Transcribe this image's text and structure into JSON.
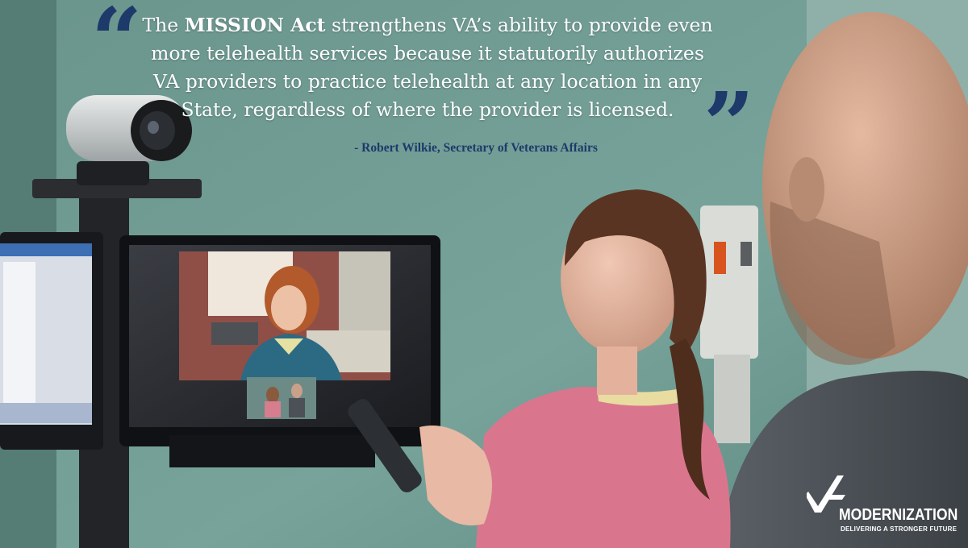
{
  "quote": {
    "line1_pre": "The ",
    "line1_bold": "MISSION Act",
    "line1_post": " strengthens VA’s ability to provide even",
    "line2": "more telehealth services because it statutorily authorizes",
    "line3": "VA providers to practice telehealth at any location in any",
    "line4": "State, regardless of where the provider is licensed.",
    "open_mark": "“",
    "close_mark": "”"
  },
  "attribution": "- Robert Wilkie, Secretary of Veterans Affairs",
  "logo": {
    "word": "MODERNIZATION",
    "tagline": "DELIVERING A STRONGER FUTURE"
  },
  "colors": {
    "wall": "#6f9a92",
    "quote_accent": "#1d3a6b",
    "scrubs": "#d9768e"
  }
}
